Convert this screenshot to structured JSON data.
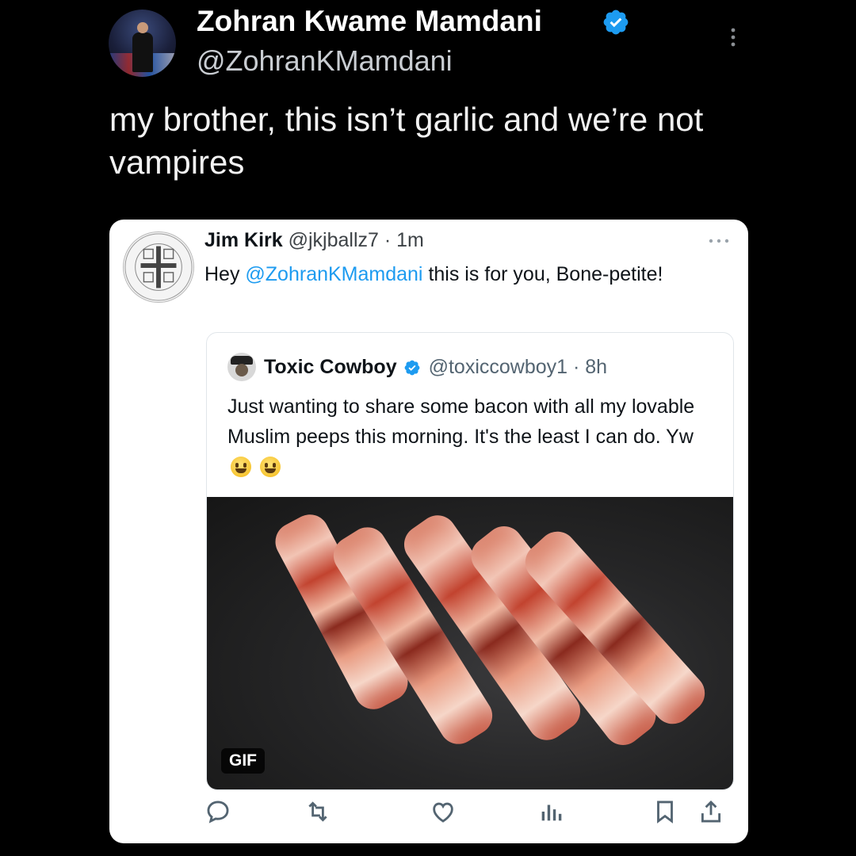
{
  "outer_tweet": {
    "name": "Zohran Kwame Mamdani",
    "handle": "@ZohranKMamdani",
    "text": "my brother, this isn’t garlic and we’re not vampires"
  },
  "quote_tweet": {
    "name": "Jim Kirk",
    "handle_time": "@jkjballz7 · 1m",
    "text_prefix": "Hey ",
    "mention": "@ZohranKMamdani",
    "text_suffix": " this is for you, Bone-petite!"
  },
  "embedded_tweet": {
    "name": "Toxic Cowboy",
    "handle_time": "@toxiccowboy1 · 8h",
    "text": "Just wanting to share some bacon with all my lovable Muslim peeps this morning. It's the least I can do. Yw",
    "media_badge": "GIF"
  },
  "icons": [
    "verified-icon",
    "more-icon",
    "reply-icon",
    "retweet-icon",
    "like-icon",
    "views-icon",
    "bookmark-icon",
    "share-icon"
  ],
  "colors": {
    "link": "#1d9bf0",
    "verified": "#1d9bf0",
    "background": "#000000",
    "card": "#ffffff"
  }
}
